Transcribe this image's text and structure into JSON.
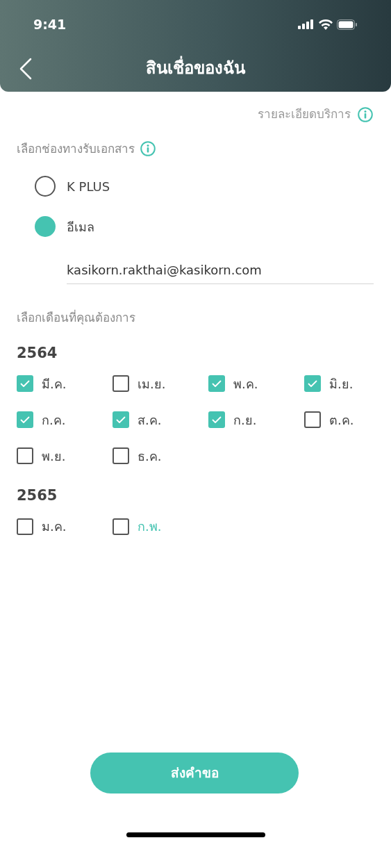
{
  "status_bar": {
    "time": "9:41"
  },
  "header": {
    "title": "สินเชื่อของฉัน"
  },
  "service_details": {
    "label": "รายละเอียดบริการ"
  },
  "channel_section": {
    "label": "เลือกช่องทางรับเอกสาร",
    "options": [
      {
        "label": "K PLUS",
        "selected": false
      },
      {
        "label": "อีเมล",
        "selected": true
      }
    ],
    "email": {
      "value": "kasikorn.rakthai@kasikorn.com"
    }
  },
  "month_section": {
    "label": "เลือกเดือนที่คุณต้องการ",
    "years": [
      {
        "year": "2564",
        "months": [
          {
            "label": "มี.ค.",
            "checked": true,
            "highlighted": false
          },
          {
            "label": "เม.ย.",
            "checked": false,
            "highlighted": false
          },
          {
            "label": "พ.ค.",
            "checked": true,
            "highlighted": false
          },
          {
            "label": "มิ.ย.",
            "checked": true,
            "highlighted": false
          },
          {
            "label": "ก.ค.",
            "checked": true,
            "highlighted": false
          },
          {
            "label": "ส.ค.",
            "checked": true,
            "highlighted": false
          },
          {
            "label": "ก.ย.",
            "checked": true,
            "highlighted": false
          },
          {
            "label": "ต.ค.",
            "checked": false,
            "highlighted": false
          },
          {
            "label": "พ.ย.",
            "checked": false,
            "highlighted": false
          },
          {
            "label": "ธ.ค.",
            "checked": false,
            "highlighted": false
          }
        ]
      },
      {
        "year": "2565",
        "months": [
          {
            "label": "ม.ค.",
            "checked": false,
            "highlighted": false
          },
          {
            "label": "ก.พ.",
            "checked": false,
            "highlighted": true
          }
        ]
      }
    ]
  },
  "submit_button": {
    "label": "ส่งคำขอ"
  }
}
